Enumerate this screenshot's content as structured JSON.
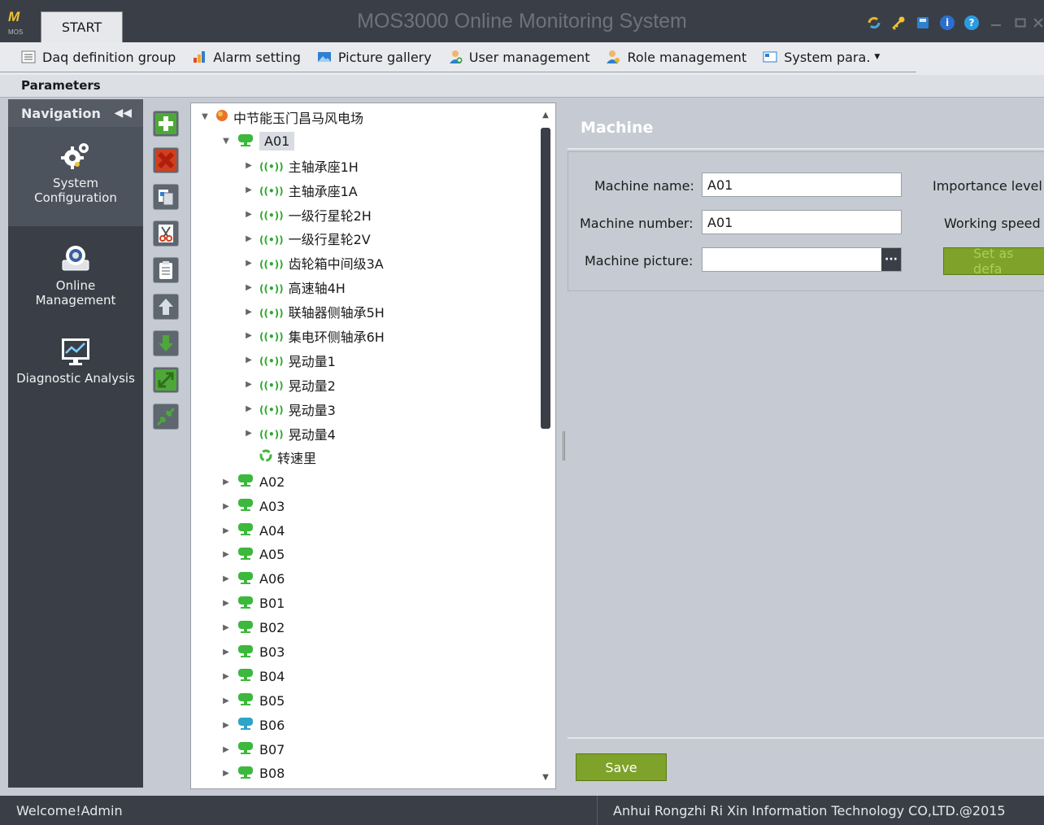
{
  "titlebar": {
    "start_tab": "START",
    "app_title": "MOS3000 Online Monitoring System"
  },
  "toolbar": {
    "items": [
      {
        "label": "Daq definition group",
        "icon": "list-icon"
      },
      {
        "label": "Alarm setting",
        "icon": "bar-chart-icon"
      },
      {
        "label": "Picture gallery",
        "icon": "picture-icon"
      },
      {
        "label": "User management",
        "icon": "user-add-icon"
      },
      {
        "label": "Role management",
        "icon": "role-icon"
      },
      {
        "label": "System para.",
        "icon": "system-para-icon"
      }
    ]
  },
  "params_bar": {
    "label": "Parameters"
  },
  "navigation": {
    "header": "Navigation",
    "items": [
      {
        "label": "System Configuration",
        "icon": "gears-icon"
      },
      {
        "label": "Online Management",
        "icon": "device-icon"
      },
      {
        "label": "Diagnostic Analysis",
        "icon": "monitor-chart-icon"
      }
    ]
  },
  "tree": {
    "root": "中节能玉门昌马风电场",
    "selected_machine": "A01",
    "a01_children": [
      "主轴承座1H",
      "主轴承座1A",
      "一级行星轮2H",
      "一级行星轮2V",
      "齿轮箱中间级3A",
      "高速轴4H",
      "联轴器侧轴承5H",
      "集电环侧轴承6H",
      "晃动量1",
      "晃动量2",
      "晃动量3",
      "晃动量4"
    ],
    "speed_node": "转速里",
    "machines": [
      "A02",
      "A03",
      "A04",
      "A05",
      "A06",
      "B01",
      "B02",
      "B03",
      "B04",
      "B05",
      "B06",
      "B07",
      "B08"
    ]
  },
  "machine_panel": {
    "title": "Machine",
    "machine_name_label": "Machine name:",
    "machine_name_value": "A01",
    "machine_number_label": "Machine number:",
    "machine_number_value": "A01",
    "machine_picture_label": "Machine picture:",
    "machine_picture_value": "",
    "importance_label": "Importance level",
    "working_speed_label": "Working speed",
    "set_default_label": "Set as defa",
    "browse_label": "···",
    "save_label": "Save"
  },
  "status": {
    "left": "Welcome!Admin",
    "right": "Anhui Rongzhi Ri Xin Information Technology CO,LTD.@2015"
  },
  "colors": {
    "dark": "#3a3f47",
    "green_button": "#7ea22a",
    "tree_green": "#2fa82f"
  }
}
